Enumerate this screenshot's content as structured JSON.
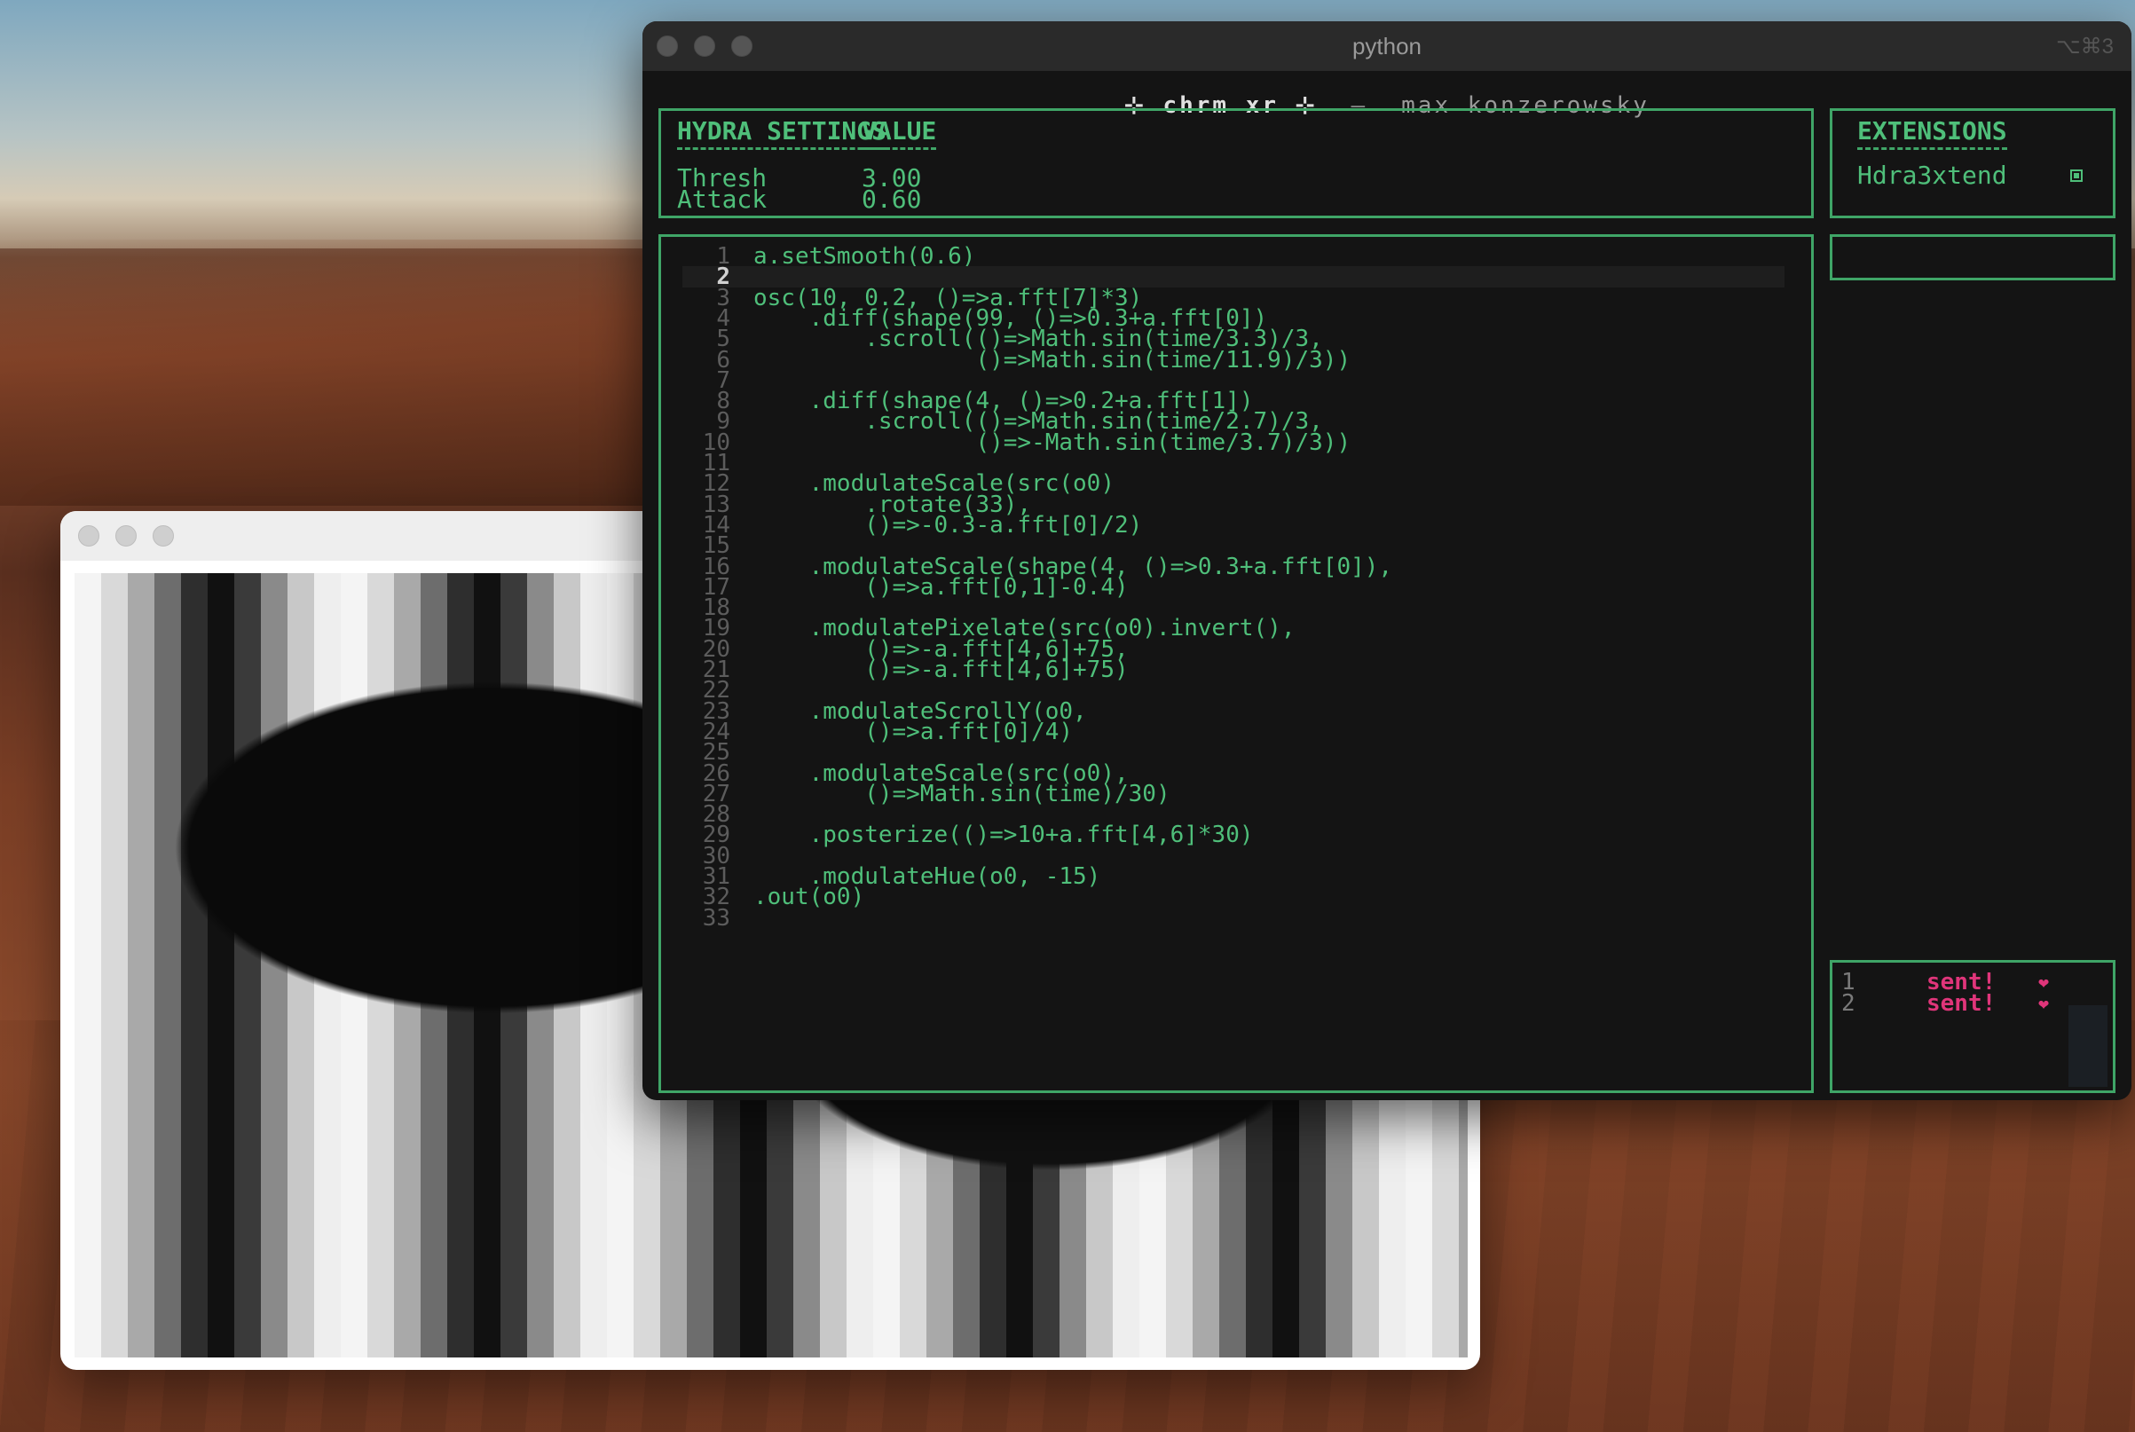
{
  "terminal": {
    "title": "python",
    "shortcut": "⌥⌘3",
    "header": {
      "brand": "⊹ chrm xr ⊹",
      "separator": "—",
      "author": "max konzerowsky"
    }
  },
  "settings": {
    "header_name": "HYDRA SETTINGS",
    "header_value": "VALUE",
    "rows": [
      {
        "name": "Thresh",
        "value": "3.00"
      },
      {
        "name": "Attack",
        "value": "0.60"
      }
    ]
  },
  "extensions": {
    "header": "EXTENSIONS",
    "items": [
      {
        "name": "Hdra3xtend"
      }
    ]
  },
  "editor": {
    "current_line": 2,
    "lines": [
      {
        "n": "1",
        "code": "a.setSmooth(0.6)"
      },
      {
        "n": "2",
        "code": ""
      },
      {
        "n": "3",
        "code": "osc(10, 0.2, ()=>a.fft[7]*3)"
      },
      {
        "n": "4",
        "code": "    .diff(shape(99, ()=>0.3+a.fft[0])"
      },
      {
        "n": "5",
        "code": "        .scroll(()=>Math.sin(time/3.3)/3,"
      },
      {
        "n": "6",
        "code": "                ()=>Math.sin(time/11.9)/3))"
      },
      {
        "n": "7",
        "code": ""
      },
      {
        "n": "8",
        "code": "    .diff(shape(4, ()=>0.2+a.fft[1])"
      },
      {
        "n": "9",
        "code": "        .scroll(()=>Math.sin(time/2.7)/3,"
      },
      {
        "n": "10",
        "code": "                ()=>-Math.sin(time/3.7)/3))"
      },
      {
        "n": "11",
        "code": ""
      },
      {
        "n": "12",
        "code": "    .modulateScale(src(o0)"
      },
      {
        "n": "13",
        "code": "        .rotate(33),"
      },
      {
        "n": "14",
        "code": "        ()=>-0.3-a.fft[0]/2)"
      },
      {
        "n": "15",
        "code": ""
      },
      {
        "n": "16",
        "code": "    .modulateScale(shape(4, ()=>0.3+a.fft[0]),"
      },
      {
        "n": "17",
        "code": "        ()=>a.fft[0,1]-0.4)"
      },
      {
        "n": "18",
        "code": ""
      },
      {
        "n": "19",
        "code": "    .modulatePixelate(src(o0).invert(),"
      },
      {
        "n": "20",
        "code": "        ()=>-a.fft[4,6]+75,"
      },
      {
        "n": "21",
        "code": "        ()=>-a.fft[4,6]+75)"
      },
      {
        "n": "22",
        "code": ""
      },
      {
        "n": "23",
        "code": "    .modulateScrollY(o0,"
      },
      {
        "n": "24",
        "code": "        ()=>a.fft[0]/4)"
      },
      {
        "n": "25",
        "code": ""
      },
      {
        "n": "26",
        "code": "    .modulateScale(src(o0),"
      },
      {
        "n": "27",
        "code": "        ()=>Math.sin(time)/30)"
      },
      {
        "n": "28",
        "code": ""
      },
      {
        "n": "29",
        "code": "    .posterize(()=>10+a.fft[4,6]*30)"
      },
      {
        "n": "30",
        "code": ""
      },
      {
        "n": "31",
        "code": "    .modulateHue(o0, -15)"
      },
      {
        "n": "32",
        "code": ".out(o0)"
      },
      {
        "n": "33",
        "code": ""
      }
    ]
  },
  "log": {
    "entries": [
      {
        "n": "1",
        "msg": "sent!",
        "icon": "heart-icon"
      },
      {
        "n": "2",
        "msg": "sent!",
        "icon": "heart-icon"
      }
    ]
  },
  "colors": {
    "accent_green": "#4fbf7a",
    "border_green": "#3fa567",
    "sent_pink": "#e0357a",
    "terminal_bg": "#141414"
  }
}
